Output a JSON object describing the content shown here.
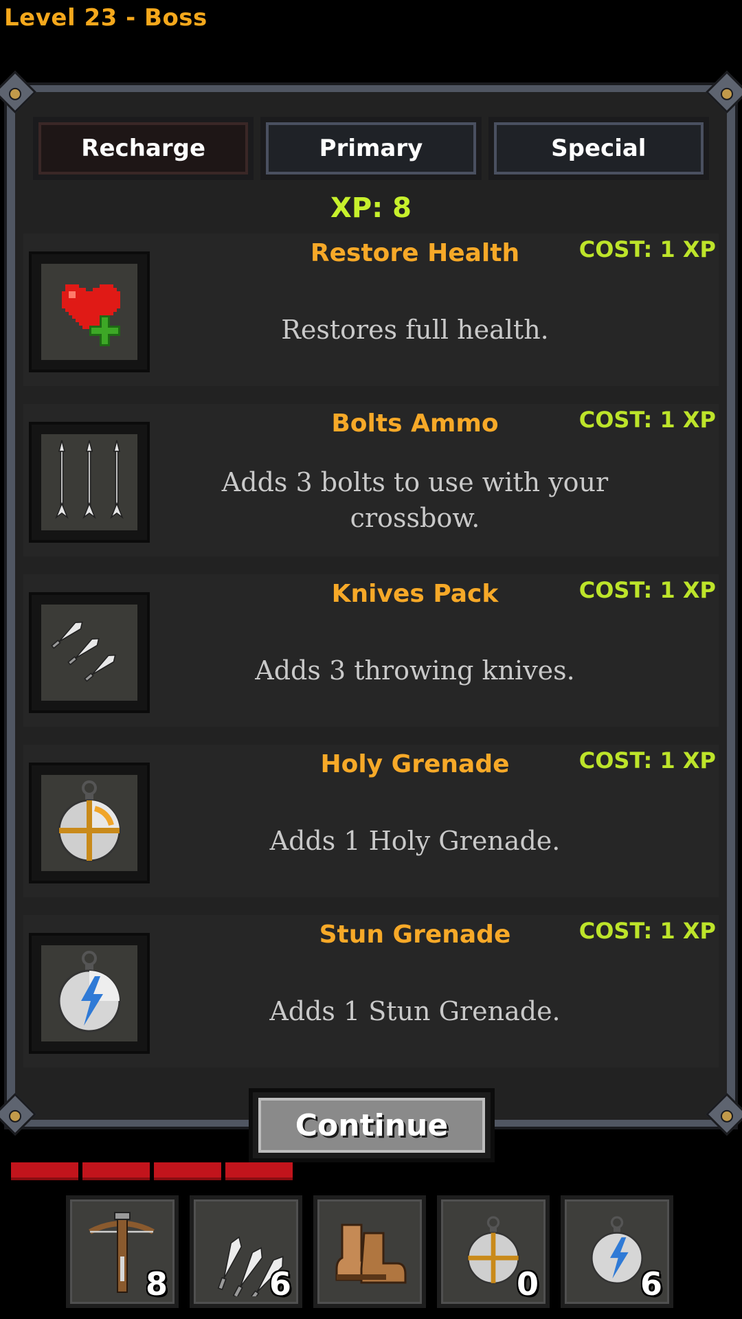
{
  "header": {
    "level_title": "Level 23 - Boss"
  },
  "tabs": [
    {
      "label": "Recharge",
      "active": true
    },
    {
      "label": "Primary",
      "active": false
    },
    {
      "label": "Special",
      "active": false
    }
  ],
  "xp_label": "XP: 8",
  "items": [
    {
      "name": "Restore Health",
      "description": "Restores full health.",
      "cost": "COST: 1 XP",
      "icon": "heart-plus-icon"
    },
    {
      "name": "Bolts Ammo",
      "description": "Adds 3 bolts to use with your crossbow.",
      "cost": "COST: 1 XP",
      "icon": "bolts-icon"
    },
    {
      "name": "Knives Pack",
      "description": "Adds 3 throwing knives.",
      "cost": "COST: 1 XP",
      "icon": "knives-icon"
    },
    {
      "name": "Holy Grenade",
      "description": "Adds 1 Holy Grenade.",
      "cost": "COST: 1 XP",
      "icon": "holy-grenade-icon"
    },
    {
      "name": "Stun Grenade",
      "description": "Adds 1 Stun Grenade.",
      "cost": "COST: 1 XP",
      "icon": "stun-grenade-icon"
    }
  ],
  "continue_label": "Continue",
  "health": {
    "segments": 4,
    "color": "#c2141c"
  },
  "inventory": [
    {
      "icon": "crossbow-icon",
      "count": "8"
    },
    {
      "icon": "knives-icon",
      "count": "6"
    },
    {
      "icon": "boots-icon",
      "count": ""
    },
    {
      "icon": "holy-grenade-icon",
      "count": "0"
    },
    {
      "icon": "stun-grenade-icon",
      "count": "6"
    }
  ],
  "colors": {
    "accent_orange": "#f7a928",
    "xp_green": "#c7f12c",
    "cost_green": "#bde42a"
  }
}
